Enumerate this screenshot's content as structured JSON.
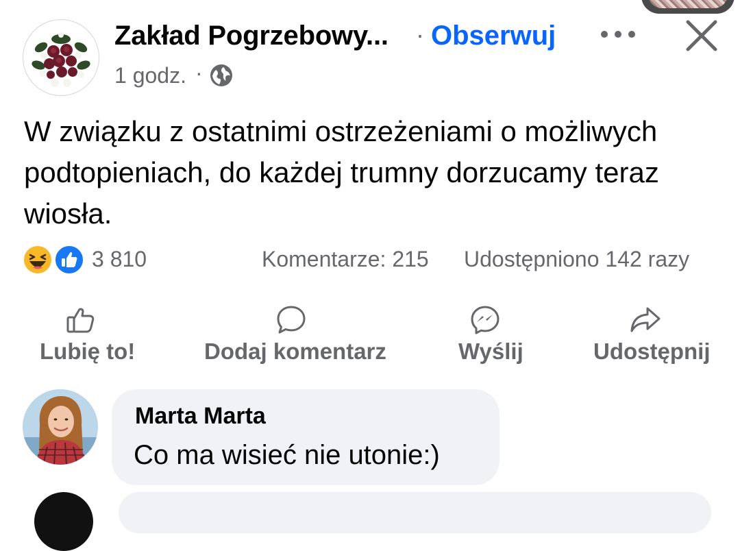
{
  "post": {
    "page_name": "Zakład Pogrzebowy...",
    "separator": "·",
    "follow_label": "Obserwuj",
    "time": "1 godz.",
    "time_separator": "·",
    "audience_icon": "globe-icon",
    "text": "W związku z ostatnimi ostrzeżeniami o możliwych podtopieniach, do każdej trumny dorzucamy teraz wiosła.",
    "reactions": {
      "icons": [
        "haha-reaction-icon",
        "like-reaction-icon"
      ],
      "count": "3 810"
    },
    "comments_count": "Komentarze: 215",
    "shares_count": "Udostępniono 142 razy"
  },
  "actions": {
    "like": {
      "label": "Lubię to!",
      "icon": "thumbs-up-icon"
    },
    "comment": {
      "label": "Dodaj komentarz",
      "icon": "comment-bubble-icon"
    },
    "send": {
      "label": "Wyślij",
      "icon": "messenger-icon"
    },
    "share": {
      "label": "Udostępnij",
      "icon": "share-arrow-icon"
    }
  },
  "comments": [
    {
      "author": "Marta Marta",
      "text": "Co ma wisieć nie utonie:)"
    }
  ],
  "colors": {
    "accent": "#0866ff",
    "secondary_text": "#65676b",
    "bubble": "#f0f2f5",
    "like_blue": "#1877f2",
    "haha_yellow": "#f7b928"
  }
}
